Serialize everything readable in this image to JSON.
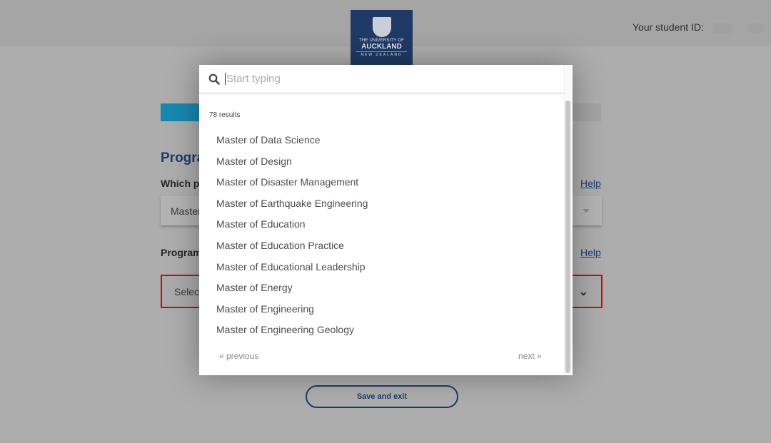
{
  "header": {
    "logo": {
      "line1": "THE UNIVERSITY OF",
      "line2": "AUCKLAND",
      "line3": "NEW ZEALAND"
    },
    "student_id_label": "Your student ID:"
  },
  "progress": {
    "percent": 10,
    "color": "#1788b0"
  },
  "form": {
    "section_title": "Programme",
    "q1_label": "Which programme",
    "q1_help": "Help",
    "q1_value": "Master",
    "q2_label": "Programme",
    "q2_help": "Help",
    "q2_value": "Select",
    "save_label": "Save and exit"
  },
  "modal": {
    "search_placeholder": "Start typing",
    "search_value": "",
    "results_count": "78 results",
    "items": [
      "Master of Data Science",
      "Master of Design",
      "Master of Disaster Management",
      "Master of Earthquake Engineering",
      "Master of Education",
      "Master of Education Practice",
      "Master of Educational Leadership",
      "Master of Energy",
      "Master of Engineering",
      "Master of Engineering Geology"
    ],
    "previous_label": "« previous",
    "next_label": "next »"
  },
  "colors": {
    "brand": "#1d3c6a",
    "error": "#c01010"
  }
}
